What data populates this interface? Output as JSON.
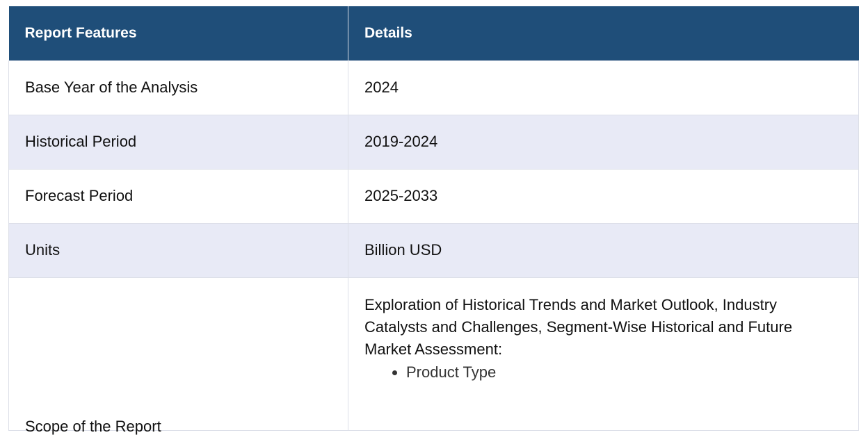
{
  "table": {
    "headers": [
      "Report Features",
      "Details"
    ],
    "rows": [
      {
        "feature": "Base Year of the Analysis",
        "details": "2024"
      },
      {
        "feature": "Historical Period",
        "details": "2019-2024"
      },
      {
        "feature": "Forecast Period",
        "details": "2025-2033"
      },
      {
        "feature": "Units",
        "details": "Billion USD"
      }
    ],
    "scope": {
      "feature": "Scope of the Report",
      "description": "Exploration of Historical Trends and Market Outlook, Industry Catalysts and Challenges, Segment-Wise Historical and Future Market Assessment:",
      "items": [
        "Product Type"
      ]
    }
  }
}
